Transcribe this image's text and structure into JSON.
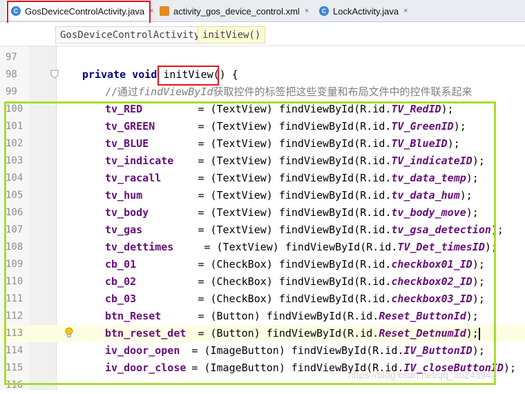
{
  "tabs": [
    {
      "label": "GosDeviceControlActivity.java",
      "icon": "class-icon",
      "active": true
    },
    {
      "label": "activity_gos_device_control.xml",
      "icon": "xml-file-icon",
      "active": false
    },
    {
      "label": "LockActivity.java",
      "icon": "class-icon",
      "active": false
    }
  ],
  "close_glyph": "×",
  "breadcrumb": [
    "GosDeviceControlActivity",
    "initView()"
  ],
  "code": {
    "line_numbers": [
      "97",
      "98",
      "99",
      "100",
      "101",
      "102",
      "103",
      "104",
      "105",
      "106",
      "107",
      "108",
      "109",
      "110",
      "111",
      "112",
      "113",
      "114",
      "115",
      "116"
    ],
    "method_line": {
      "kw": "private void ",
      "name": "initView()",
      "rest": " {"
    },
    "comment_line": {
      "prefix": "//通过",
      "ital": "findViewById",
      "suffix": "获取控件的标签把这些变量和布局文件中的控件联系起来"
    },
    "statements": [
      {
        "field": "tv_RED",
        "pad": "        ",
        "cast": "= (TextView) findViewById(R.id.",
        "const": "TV_RedID",
        "end": ");"
      },
      {
        "field": "tv_GREEN",
        "pad": "      ",
        "cast": "= (TextView) findViewById(R.id.",
        "const": "TV_GreenID",
        "end": ");"
      },
      {
        "field": "tv_BLUE",
        "pad": "       ",
        "cast": "= (TextView) findViewById(R.id.",
        "const": "TV_BlueID",
        "end": ");"
      },
      {
        "field": "tv_indicate",
        "pad": "   ",
        "cast": "= (TextView) findViewById(R.id.",
        "const": "TV_indicateID",
        "end": ");"
      },
      {
        "field": "tv_racall",
        "pad": "     ",
        "cast": "= (TextView) findViewById(R.id.",
        "const": "tv_data_temp",
        "end": ");"
      },
      {
        "field": "tv_hum",
        "pad": "        ",
        "cast": "= (TextView) findViewById(R.id.",
        "const": "tv_data_hum",
        "end": ");"
      },
      {
        "field": "tv_body",
        "pad": "       ",
        "cast": "= (TextView) findViewById(R.id.",
        "const": "tv_body_move",
        "end": ");"
      },
      {
        "field": "tv_gas",
        "pad": "        ",
        "cast": "= (TextView) findViewById(R.id.",
        "const": "tv_gsa_detection",
        "end": ");"
      },
      {
        "field": "tv_dettimes",
        "pad": "    ",
        "cast": "= (TextView) findViewById(R.id.",
        "const": "TV_Det_timesID",
        "end": ");"
      },
      {
        "field": "cb_01",
        "pad": "         ",
        "cast": "= (CheckBox) findViewById(R.id.",
        "const": "checkbox01_ID",
        "end": ");"
      },
      {
        "field": "cb_02",
        "pad": "         ",
        "cast": "= (CheckBox) findViewById(R.id.",
        "const": "checkbox02_ID",
        "end": ");"
      },
      {
        "field": "cb_03",
        "pad": "         ",
        "cast": "= (CheckBox) findViewById(R.id.",
        "const": "checkbox03_ID",
        "end": ");"
      },
      {
        "field": "btn_Reset",
        "pad": "     ",
        "cast": "= (Button) findViewById(R.id.",
        "const": "Reset_ButtonId",
        "end": ");"
      },
      {
        "field": "btn_reset_det",
        "pad": " ",
        "cast": "= (Button) findViewById(R.id.",
        "const": "Reset_DetnumId",
        "end": ");"
      },
      {
        "field": "iv_door_open",
        "pad": " ",
        "cast": "= (ImageButton) findViewById(R.id.",
        "const": "IV_ButtonID",
        "end": ");"
      },
      {
        "field": "iv_door_close",
        "pad": "",
        "cast": "= (ImageButton) findViewById(R.id.",
        "const": "IV_closeButtonID",
        "end": ");"
      }
    ]
  },
  "watermark": "https://blog.csdn.net/qq_36243942",
  "colors": {
    "highlight_red": "#e8111a",
    "highlight_green": "#a8dd2c",
    "keyword": "#000080",
    "field": "#660e7a",
    "comment": "#808080"
  }
}
